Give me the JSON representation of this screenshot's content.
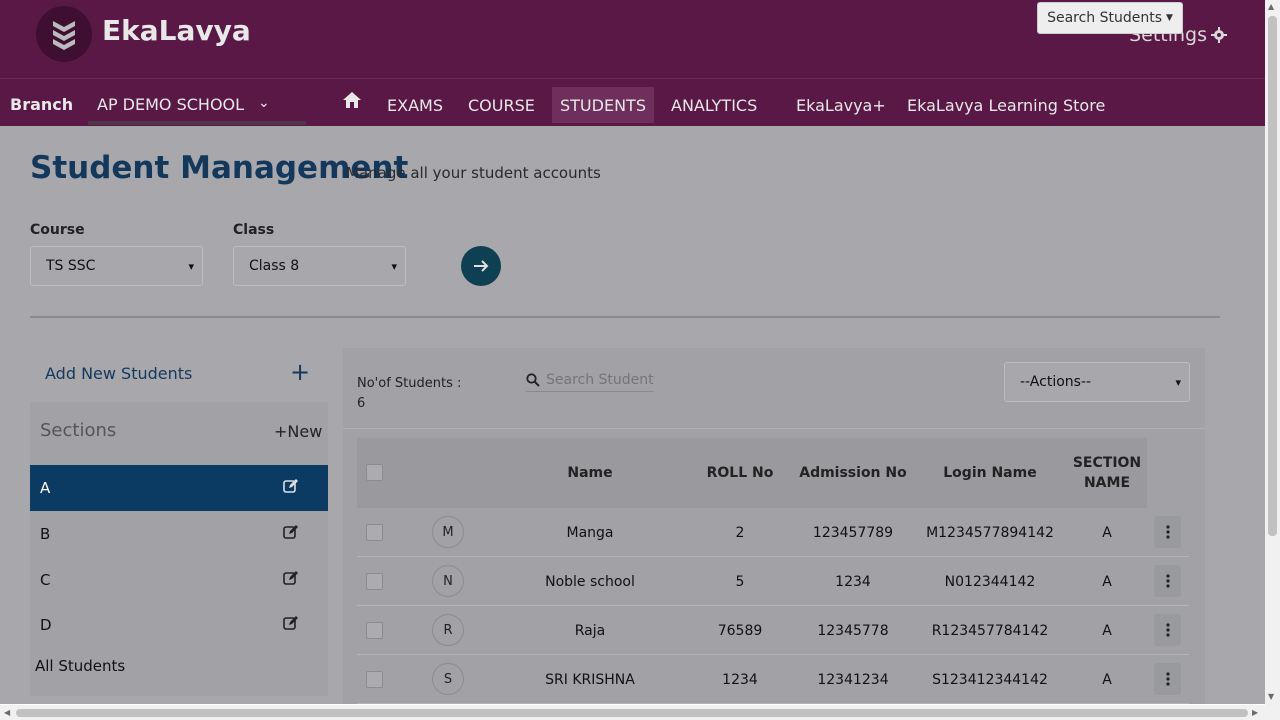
{
  "header": {
    "brand": "EkaLavya",
    "settings_label": "Settings",
    "search_students_label": "Search Students"
  },
  "nav": {
    "branch_label": "Branch",
    "school": "AP DEMO SCHOOL",
    "items": [
      {
        "label": "EXAMS"
      },
      {
        "label": "COURSE"
      },
      {
        "label": "STUDENTS",
        "active": true
      },
      {
        "label": "ANALYTICS"
      },
      {
        "label": "EkaLavya+"
      },
      {
        "label": "EkaLavya Learning Store"
      }
    ]
  },
  "page": {
    "title": "Student Management",
    "subtitle": "Manage all your student accounts"
  },
  "filters": {
    "course_label": "Course",
    "course_value": "TS SSC",
    "class_label": "Class",
    "class_value": "Class 8"
  },
  "left": {
    "add_new_label": "Add New Students",
    "sections_label": "Sections",
    "new_label": "+New",
    "sections": [
      {
        "name": "A",
        "active": true
      },
      {
        "name": "B"
      },
      {
        "name": "C"
      },
      {
        "name": "D"
      }
    ],
    "all_students_label": "All Students"
  },
  "right": {
    "count_label": "No'of Students :",
    "count_value": "6",
    "search_placeholder": "Search Students",
    "actions_value": "--Actions--",
    "columns": {
      "name": "Name",
      "roll": "ROLL No",
      "admission": "Admission No",
      "login": "Login Name",
      "section_line1": "SECTION",
      "section_line2": "NAME"
    },
    "rows": [
      {
        "initial": "M",
        "name": "Manga",
        "roll": "2",
        "admission": "123457789",
        "login": "M1234577894142",
        "section": "A"
      },
      {
        "initial": "N",
        "name": "Noble school",
        "roll": "5",
        "admission": "1234",
        "login": "N012344142",
        "section": "A"
      },
      {
        "initial": "R",
        "name": "Raja",
        "roll": "76589",
        "admission": "12345778",
        "login": "R123457784142",
        "section": "A"
      },
      {
        "initial": "S",
        "name": "SRI KRISHNA",
        "roll": "1234",
        "admission": "12341234",
        "login": "S123412344142",
        "section": "A"
      }
    ]
  },
  "colors": {
    "header_bg": "#5a1846",
    "title_blue": "#14385c",
    "active_section": "#0b3b63",
    "go_button": "#0f3f52"
  }
}
